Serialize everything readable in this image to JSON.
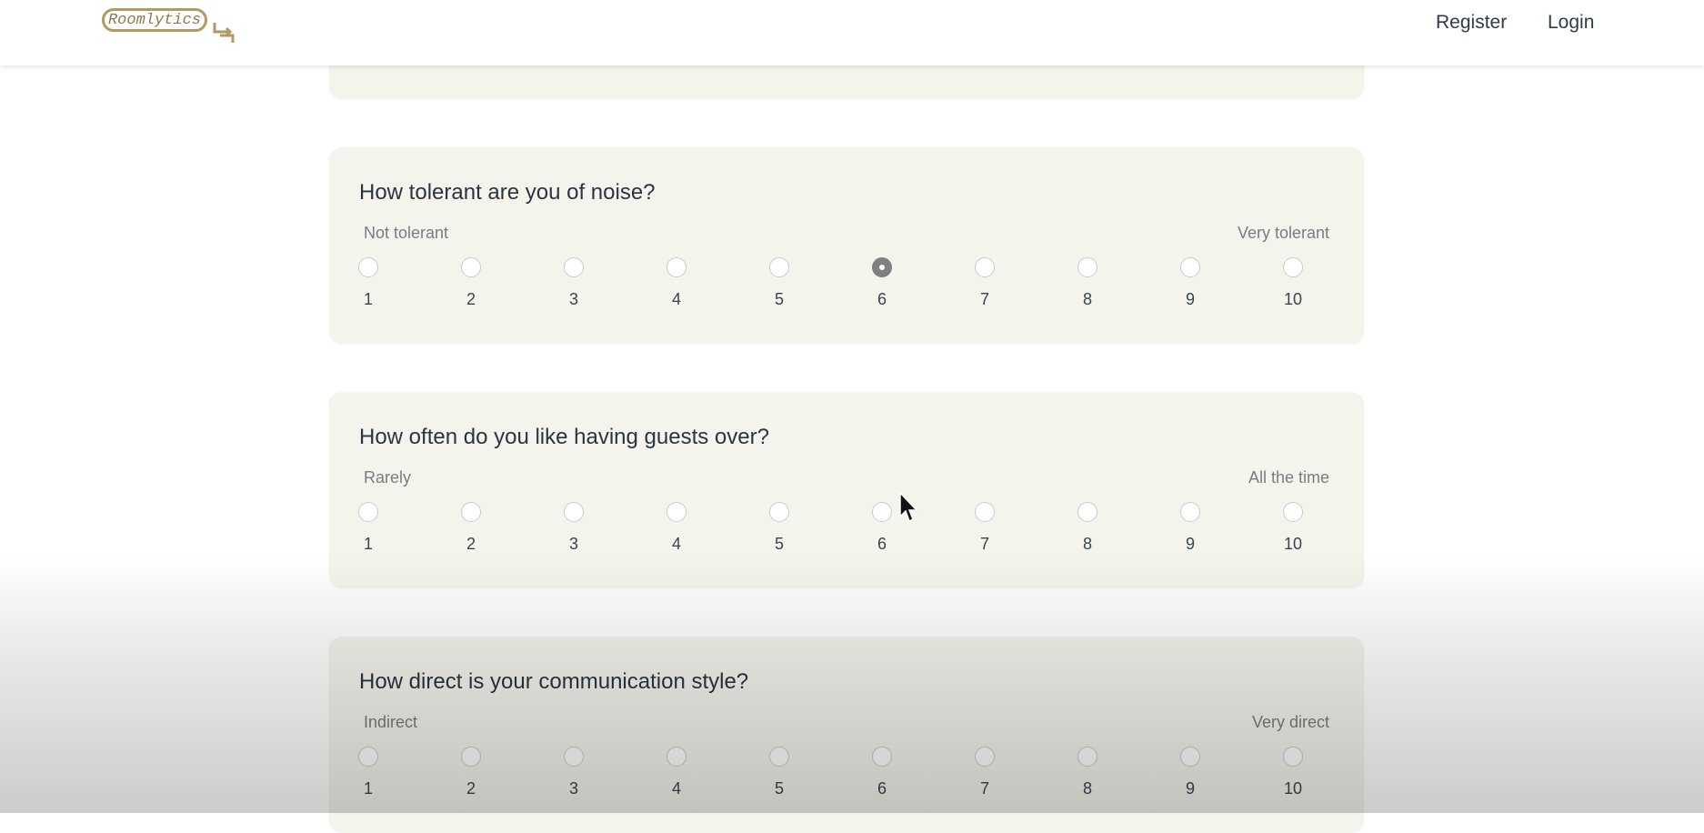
{
  "header": {
    "logo_text": "Roomlytics",
    "nav": {
      "register": "Register",
      "login": "Login"
    }
  },
  "questions": [
    {
      "title": "How tolerant are you of noise?",
      "min_label": "Not tolerant",
      "max_label": "Very tolerant",
      "options": [
        "1",
        "2",
        "3",
        "4",
        "5",
        "6",
        "7",
        "8",
        "9",
        "10"
      ],
      "selected": "6"
    },
    {
      "title": "How often do you like having guests over?",
      "min_label": "Rarely",
      "max_label": "All the time",
      "options": [
        "1",
        "2",
        "3",
        "4",
        "5",
        "6",
        "7",
        "8",
        "9",
        "10"
      ],
      "selected": null
    },
    {
      "title": "How direct is your communication style?",
      "min_label": "Indirect",
      "max_label": "Very direct",
      "options": [
        "1",
        "2",
        "3",
        "4",
        "5",
        "6",
        "7",
        "8",
        "9",
        "10"
      ],
      "selected": null
    }
  ],
  "colors": {
    "card_bg": "#f4f4ed",
    "logo_gold": "#b09a63",
    "radio_checked": "#7f7f7f"
  }
}
